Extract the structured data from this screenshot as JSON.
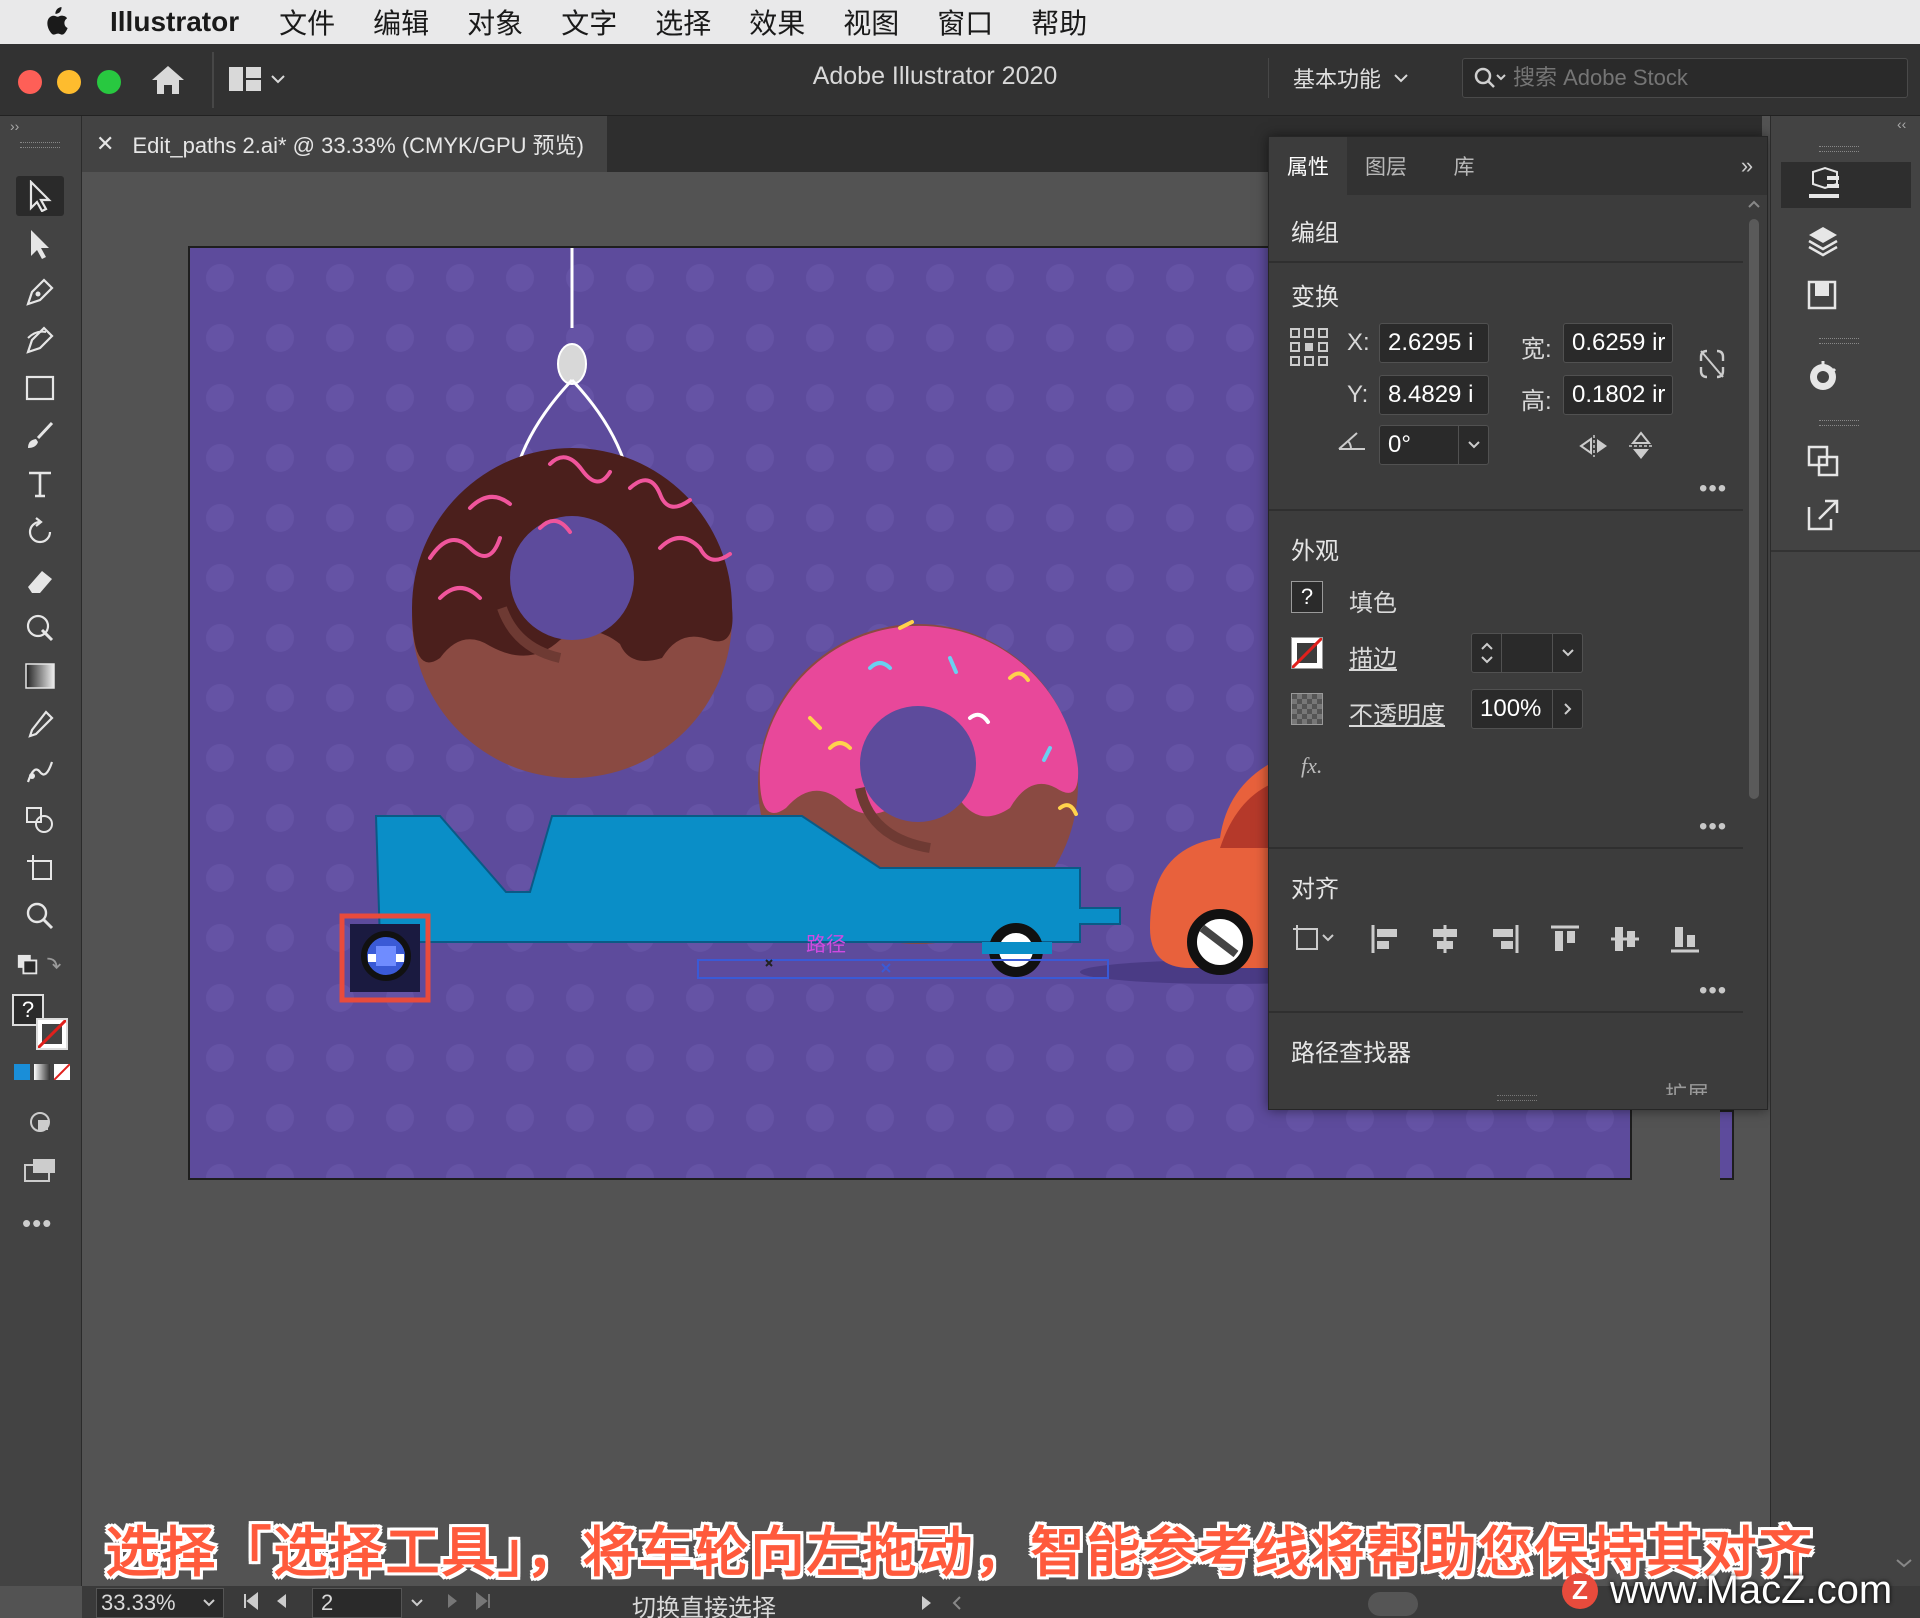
{
  "menubar": {
    "app_name": "Illustrator",
    "items": [
      "文件",
      "编辑",
      "对象",
      "文字",
      "选择",
      "效果",
      "视图",
      "窗口",
      "帮助"
    ]
  },
  "appbar": {
    "title": "Adobe Illustrator 2020",
    "workspace": "基本功能",
    "search_placeholder": "搜索 Adobe Stock"
  },
  "document": {
    "tab_title": "Edit_paths 2.ai* @ 33.33% (CMYK/GPU 预览)",
    "path_label": "路径"
  },
  "properties": {
    "tabs": [
      "属性",
      "图层",
      "库"
    ],
    "selection_type": "编组",
    "transform": {
      "title": "变换",
      "x_label": "X:",
      "x": "2.6295 i",
      "y_label": "Y:",
      "y": "8.4829 i",
      "w_label": "宽:",
      "w": "0.6259 ir",
      "h_label": "高:",
      "h": "0.1802 ir",
      "angle": "0°"
    },
    "appearance": {
      "title": "外观",
      "fill_label": "填色",
      "fill_value": "?",
      "stroke_label": "描边",
      "opacity_label": "不透明度",
      "opacity": "100%",
      "fx": "fx."
    },
    "align": {
      "title": "对齐"
    },
    "pathfinder": {
      "title": "路径查找器",
      "expand_label": "扩展"
    }
  },
  "statusbar": {
    "zoom": "33.33%",
    "artboard": "2",
    "status": "切换直接选择"
  },
  "overlay": {
    "subtitle": "选择「选择工具」，将车轮向左拖动，智能参考线将帮助您保持其对齐",
    "watermark": "www.MacZ.com",
    "watermark_badge": "Z"
  },
  "colors": {
    "artboard": "#5d4b9c",
    "trailer": "#0a8ec7",
    "donut_chocolate": "#4b1f1c",
    "donut_pink": "#e8489a",
    "donut_dough": "#8a4a42",
    "car": "#e8613c",
    "highlight": "#e84b3c"
  }
}
